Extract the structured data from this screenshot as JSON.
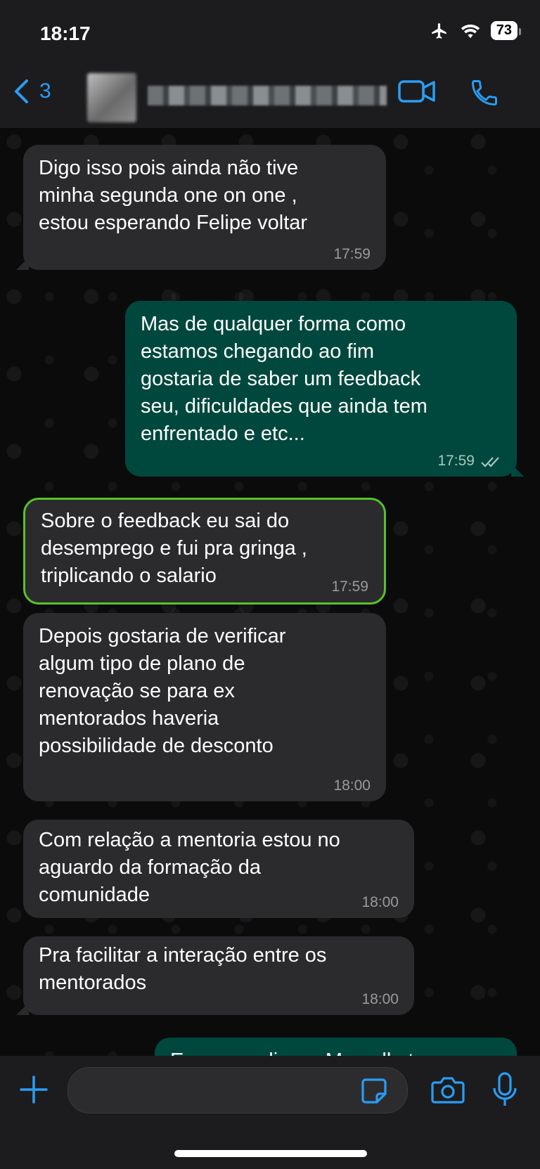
{
  "status": {
    "time": "18:17",
    "battery": "73"
  },
  "header": {
    "back_count": "3",
    "contact_name": "██████████",
    "accent": "#2a9df4"
  },
  "messages": [
    {
      "dir": "in",
      "text": "Digo isso pois ainda não tive\nminha segunda one on one ,\nestou esperando Felipe voltar",
      "time": "17:59"
    },
    {
      "dir": "out",
      "text": "Mas de qualquer forma como\nestamos chegando ao fim\ngostaria de saber um feedback\nseu, dificuldades que ainda tem\nenfrentado e etc...",
      "time": "17:59",
      "status": "read"
    },
    {
      "dir": "in",
      "text": "Sobre o feedback eu sai do\ndesemprego e fui pra gringa ,\ntriplicando o salario",
      "time": "17:59",
      "highlighted": true
    },
    {
      "dir": "in",
      "text": "Depois gostaria de verificar\nalgum tipo de plano de\nrenovação se para ex\nmentorados haveria\npossibilidade de desconto",
      "time": "18:00"
    },
    {
      "dir": "in",
      "text": "Com relação a mentoria estou no\naguardo da formação da\ncomunidade",
      "time": "18:00"
    },
    {
      "dir": "in",
      "text": "Pra facilitar a interação entre os\nmentorados",
      "time": "18:00"
    },
    {
      "dir": "out",
      "text": "Eu vou pedir pra Marcelle te",
      "time": ""
    }
  ],
  "composer": {
    "placeholder": ""
  },
  "colors": {
    "incoming_bubble": "#2b2b2d",
    "outgoing_bubble": "#00483d",
    "highlight_border": "#57c22a"
  }
}
